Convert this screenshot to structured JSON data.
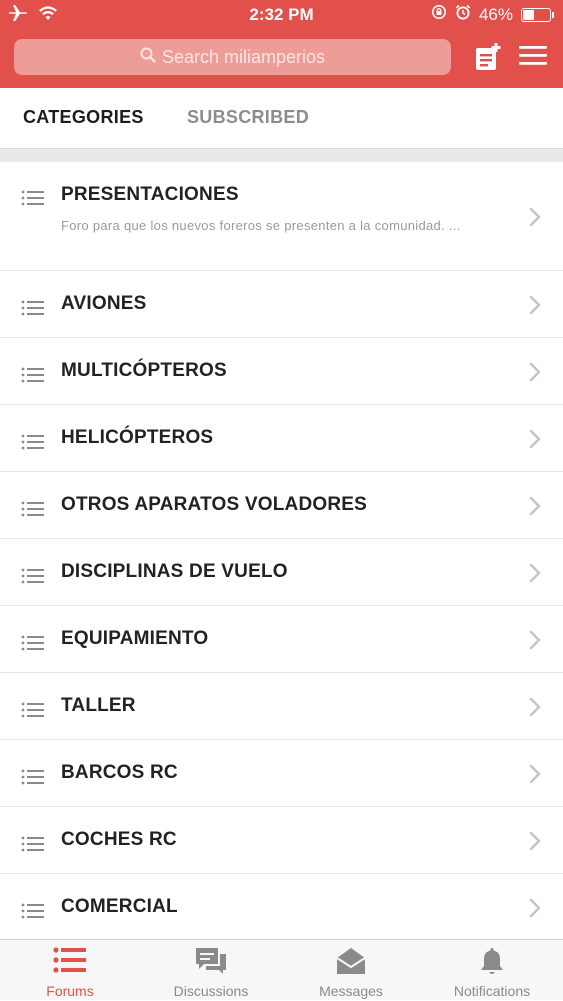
{
  "status_bar": {
    "time": "2:32 PM",
    "battery": "46%",
    "battery_level": 0.46
  },
  "header": {
    "search_placeholder": "Search miliamperios"
  },
  "tabs": [
    {
      "label": "CATEGORIES",
      "active": true
    },
    {
      "label": "SUBSCRIBED",
      "active": false
    }
  ],
  "categories": [
    {
      "title": "PRESENTACIONES",
      "description": "Foro para que los nuevos foreros se presenten a la comunidad. ..."
    },
    {
      "title": "AVIONES"
    },
    {
      "title": "MULTICÓPTEROS"
    },
    {
      "title": "HELICÓPTEROS"
    },
    {
      "title": "OTROS APARATOS VOLADORES"
    },
    {
      "title": "DISCIPLINAS DE VUELO"
    },
    {
      "title": "EQUIPAMIENTO"
    },
    {
      "title": "TALLER"
    },
    {
      "title": "BARCOS RC"
    },
    {
      "title": "COCHES RC"
    },
    {
      "title": "COMERCIAL"
    }
  ],
  "bottom_nav": [
    {
      "label": "Forums",
      "icon": "forums-list-icon",
      "active": true
    },
    {
      "label": "Discussions",
      "icon": "discussions-icon",
      "active": false
    },
    {
      "label": "Messages",
      "icon": "messages-envelope-icon",
      "active": false
    },
    {
      "label": "Notifications",
      "icon": "notifications-bell-icon",
      "active": false
    }
  ],
  "colors": {
    "accent": "#e1504a",
    "search_bg": "#ee9c98",
    "muted": "#8c8c8c"
  }
}
